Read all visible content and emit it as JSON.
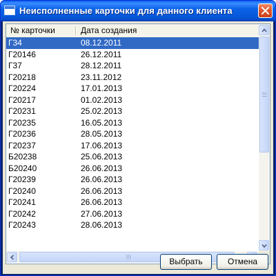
{
  "window": {
    "title": "Неисполненные карточки для данного клиента"
  },
  "table": {
    "columns": [
      "№ карточки",
      "Дата создания"
    ],
    "rows": [
      {
        "card": "Г34",
        "date": "08.12.2011"
      },
      {
        "card": "Г20146",
        "date": "26.12.2011"
      },
      {
        "card": "Г37",
        "date": "28.12.2011"
      },
      {
        "card": "Г20218",
        "date": "23.11.2012"
      },
      {
        "card": "Г20224",
        "date": "17.01.2013"
      },
      {
        "card": "Г20217",
        "date": "01.02.2013"
      },
      {
        "card": "Г20231",
        "date": "25.02.2013"
      },
      {
        "card": "Г20235",
        "date": "16.05.2013"
      },
      {
        "card": "Г20236",
        "date": "28.05.2013"
      },
      {
        "card": "Г20237",
        "date": "17.06.2013"
      },
      {
        "card": "Б20238",
        "date": "25.06.2013"
      },
      {
        "card": "Б20240",
        "date": "26.06.2013"
      },
      {
        "card": "Г20239",
        "date": "26.06.2013"
      },
      {
        "card": "Г20240",
        "date": "26.06.2013"
      },
      {
        "card": "Г20241",
        "date": "26.06.2013"
      },
      {
        "card": "Г20242",
        "date": "27.06.2013"
      },
      {
        "card": "Г20243",
        "date": "28.06.2013"
      }
    ],
    "selected_index": 0
  },
  "buttons": {
    "select": "Выбрать",
    "cancel": "Отмена"
  },
  "icons": {
    "window": "window-icon",
    "close": "close-icon",
    "scroll_up": "arrow-up-icon",
    "scroll_down": "arrow-down-icon",
    "scroll_left": "arrow-left-icon",
    "scroll_right": "arrow-right-icon"
  },
  "colors": {
    "titlebar": "#0b62e6",
    "selection": "#316ac5",
    "close_button": "#e2582d"
  }
}
